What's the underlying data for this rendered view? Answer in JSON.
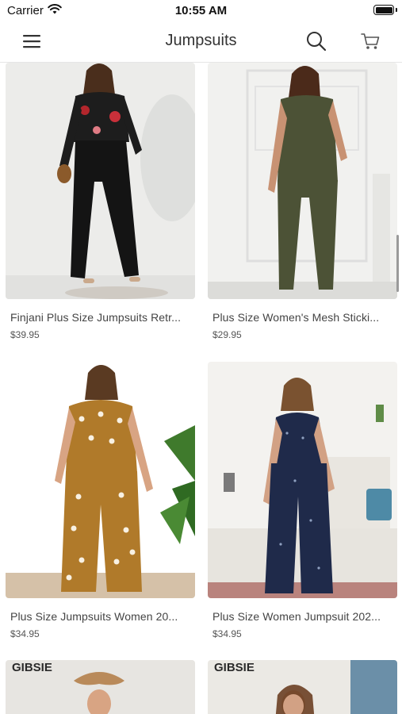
{
  "status_bar": {
    "carrier": "Carrier",
    "time": "10:55 AM"
  },
  "nav": {
    "title": "Jumpsuits"
  },
  "icons": {
    "menu": "hamburger-menu-icon",
    "search": "search-icon",
    "cart": "shopping-cart-icon"
  },
  "products": [
    {
      "title": "Finjani Plus Size Jumpsuits Retr...",
      "price": "$39.95",
      "outfit_color": "#141414",
      "top_color": "#1d1d1d"
    },
    {
      "title": "Plus Size Women's Mesh Sticki...",
      "price": "$29.95",
      "outfit_color": "#4c5236",
      "top_color": "#4c5236"
    },
    {
      "title": "Plus Size Jumpsuits Women 20...",
      "price": "$34.95",
      "outfit_color": "#b07a2a",
      "top_color": "#b07a2a"
    },
    {
      "title": "Plus Size Women Jumpsuit 202...",
      "price": "$34.95",
      "outfit_color": "#1f2a4a",
      "top_color": "#1f2a4a"
    }
  ],
  "partial_cards": [
    {
      "brand_watermark": "GIBSIE"
    },
    {
      "brand_watermark": "GIBSIE"
    }
  ]
}
